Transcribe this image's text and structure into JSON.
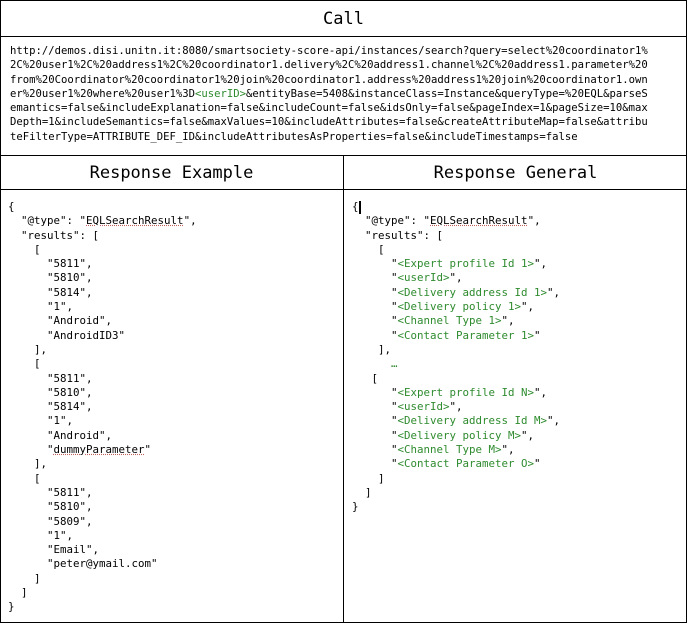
{
  "call": {
    "title": "Call",
    "line1": "http://demos.disi.unitn.it:8080/smartsociety-score-api/instances/search?query=select%20coordinator1%",
    "line2": "2C%20user1%2C%20address1%2C%20coordinator1.delivery%2C%20address1.channel%2C%20address1.parameter%20",
    "line3": "from%20Coordinator%20coordinator1%20join%20coordinator1.address%20address1%20join%20coordinator1.own",
    "line4_a": "er%20user1%20where%20user1%3D",
    "line4_var": "<userID>",
    "line4_b": "&entityBase=5408&instanceClass=Instance&queryType=%20EQL&parseS",
    "line5": "emantics=false&includeExplanation=false&includeCount=false&idsOnly=false&pageIndex=1&pageSize=10&max",
    "line6": "Depth=1&includeSemantics=false&maxValues=10&includeAttributes=false&createAttributeMap=false&attribu",
    "line7": "teFilterType=ATTRIBUTE_DEF_ID&includeAttributesAsProperties=false&includeTimestamps=false"
  },
  "response_example": {
    "title": "Response Example",
    "type_key": "\"@type\"",
    "type_value": "EQLSearchResult",
    "results_key": "\"results\"",
    "groups": [
      [
        "\"5811\",",
        "\"5810\",",
        "\"5814\",",
        "\"1\",",
        "\"Android\",",
        "\"AndroidID3\""
      ],
      [
        "\"5811\",",
        "\"5810\",",
        "\"5814\",",
        "\"1\",",
        "\"Android\","
      ],
      [
        "\"5811\",",
        "\"5810\",",
        "\"5809\",",
        "\"1\",",
        "\"Email\",",
        "\"peter@ymail.com\""
      ]
    ],
    "dummy_value": "dummyParameter"
  },
  "response_general": {
    "title": "Response General",
    "type_key": "\"@type\"",
    "type_value": "EQLSearchResult",
    "results_key": "\"results\"",
    "group1": [
      "<Expert profile Id 1>",
      "<userId>",
      "<Delivery address Id 1>",
      "<Delivery policy 1>",
      "<Channel Type 1>",
      "<Contact Parameter 1>"
    ],
    "ellipsis": "…",
    "groupN": [
      "<Expert profile Id N>",
      "<userId>",
      "<Delivery address Id M>",
      "<Delivery policy M>",
      "<Channel Type M>",
      "<Contact Parameter O>"
    ]
  }
}
